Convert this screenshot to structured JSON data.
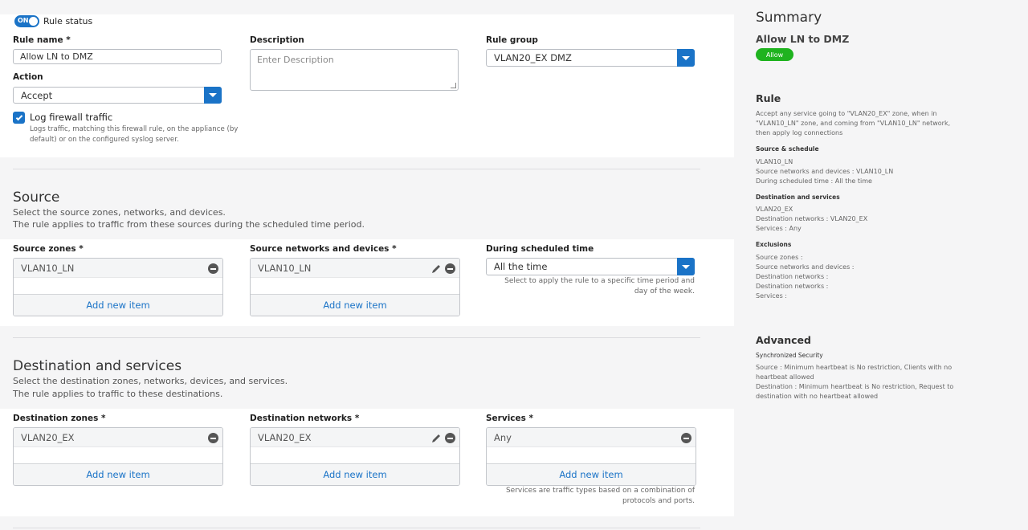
{
  "rule_status": {
    "toggle": "ON",
    "label": "Rule status"
  },
  "rule_name": {
    "label": "Rule name *",
    "value": "Allow LN to DMZ"
  },
  "description": {
    "label": "Description",
    "placeholder": "Enter Description"
  },
  "rule_group": {
    "label": "Rule group",
    "value": "VLAN20_EX DMZ"
  },
  "action": {
    "label": "Action",
    "value": "Accept"
  },
  "log": {
    "label": "Log firewall traffic",
    "hint_line1": "Logs traffic, matching this firewall rule, on the appliance (by",
    "hint_line2": "default) or on the configured syslog server."
  },
  "source": {
    "title": "Source",
    "desc_line1": "Select the source zones, networks, and devices.",
    "desc_line2": "The rule applies to traffic from these sources during the scheduled time period.",
    "zones": {
      "label": "Source zones *",
      "item": "VLAN10_LN",
      "add": "Add new item"
    },
    "networks": {
      "label": "Source networks and devices *",
      "item": "VLAN10_LN",
      "add": "Add new item"
    },
    "schedule": {
      "label": "During scheduled time",
      "value": "All the time",
      "hint_line1": "Select to apply the rule to a specific time period and",
      "hint_line2": "day of the week."
    }
  },
  "destination": {
    "title": "Destination and services",
    "desc_line1": "Select the destination zones, networks, devices, and services.",
    "desc_line2": "The rule applies to traffic to these destinations.",
    "zones": {
      "label": "Destination zones *",
      "item": "VLAN20_EX",
      "add": "Add new item"
    },
    "networks": {
      "label": "Destination networks *",
      "item": "VLAN20_EX",
      "add": "Add new item"
    },
    "services": {
      "label": "Services *",
      "item": "Any",
      "add": "Add new item",
      "hint_line1": "Services are traffic types based on a combination of",
      "hint_line2": "protocols and ports."
    }
  },
  "summary": {
    "title": "Summary",
    "rule_name": "Allow LN to DMZ",
    "badge": "Allow",
    "rule_heading": "Rule",
    "rule_text_1": "Accept any service going to \"VLAN20_EX\" zone, when in",
    "rule_text_2": "\"VLAN10_LN\" zone, and coming from \"VLAN10_LN\" network,",
    "rule_text_3": "then apply log connections",
    "src_heading": "Source & schedule",
    "src_1": "VLAN10_LN",
    "src_2": "Source networks and devices : VLAN10_LN",
    "src_3": "During scheduled time : All the time",
    "dst_heading": "Destination and services",
    "dst_1": "VLAN20_EX",
    "dst_2": "Destination networks : VLAN20_EX",
    "dst_3": "Services : Any",
    "exc_heading": "Exclusions",
    "exc_1": "Source zones :",
    "exc_2": "Source networks and devices :",
    "exc_3": "Destination networks :",
    "exc_4": "Destination networks :",
    "exc_5": "Services :",
    "adv_heading": "Advanced",
    "sync_heading": "Synchronized Security",
    "sync_1": "Source : Minimum heartbeat is No restriction, Clients with no",
    "sync_2": "heartbeat allowed",
    "sync_3": "Destination : Minimum heartbeat is No restriction, Request to",
    "sync_4": "destination with no heartbeat allowed"
  },
  "colors": {
    "accent": "#1a73c7",
    "badge": "#1fb31f"
  }
}
